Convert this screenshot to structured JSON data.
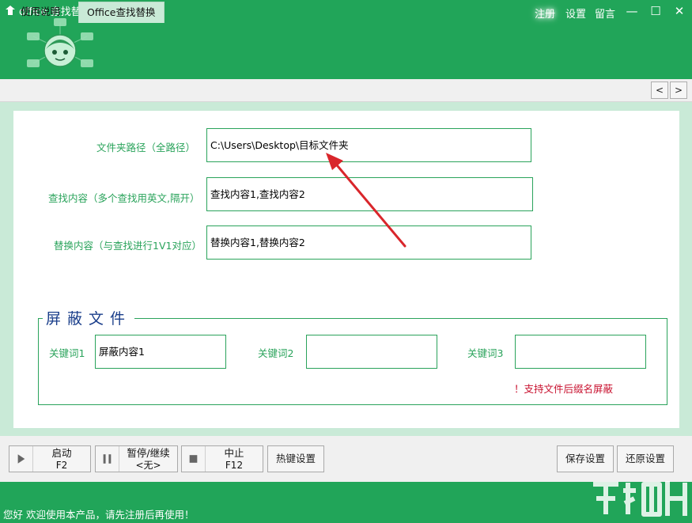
{
  "window": {
    "title": "office 查找替换",
    "links": {
      "register": "注册",
      "settings": "设置",
      "message": "留言"
    },
    "controls": {
      "minimize": "—",
      "maximize": "☐",
      "close": "✕"
    }
  },
  "tabs": [
    {
      "label": "使用说明"
    },
    {
      "label": "Office查找替换"
    }
  ],
  "tab_nav": {
    "prev": "<",
    "next": ">"
  },
  "form": {
    "folder_label": "文件夹路径（全路径）",
    "folder_value": "C:\\Users\\Desktop\\目标文件夹",
    "find_label": "查找内容（多个查找用英文,隔开）",
    "find_value": "查找内容1,查找内容2",
    "replace_label": "替换内容（与查找进行1V1对应）",
    "replace_value": "替换内容1,替换内容2"
  },
  "shield": {
    "title": "屏蔽文件",
    "kw1_label": "关键词1",
    "kw1_value": "屏蔽内容1",
    "kw2_label": "关键词2",
    "kw2_value": "",
    "kw3_label": "关键词3",
    "kw3_value": "",
    "hint": "！支持文件后缀名屏蔽"
  },
  "toolbar": {
    "start": {
      "label": "启动",
      "key": "F2"
    },
    "pause": {
      "label": "暂停/继续",
      "key": "<无>"
    },
    "stop": {
      "label": "中止",
      "key": "F12"
    },
    "hotkey_label": "热键设置",
    "save_label": "保存设置",
    "restore_label": "还原设置"
  },
  "status": {
    "text": "您好 欢迎使用本产品，请先注册后再使用！"
  },
  "colors": {
    "brand_green": "#21a559",
    "field_border": "#2aa35b",
    "content_bg": "#c9ead7",
    "hint_red": "#c8102e",
    "arrow_red": "#d9262b",
    "group_title": "#1b3f8b"
  }
}
